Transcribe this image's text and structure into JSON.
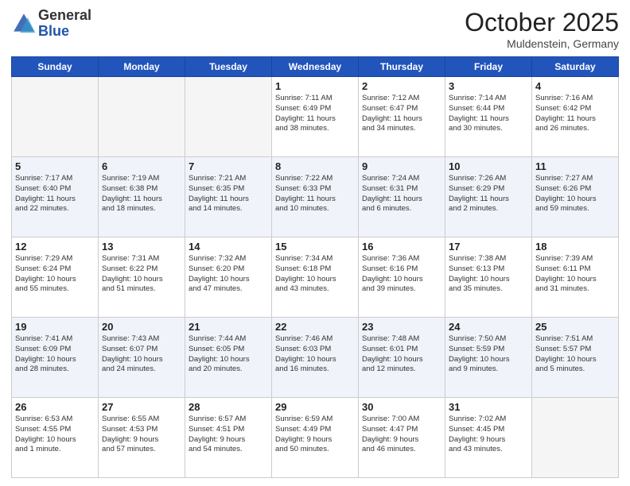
{
  "header": {
    "logo_general": "General",
    "logo_blue": "Blue",
    "month_title": "October 2025",
    "location": "Muldenstein, Germany"
  },
  "days_of_week": [
    "Sunday",
    "Monday",
    "Tuesday",
    "Wednesday",
    "Thursday",
    "Friday",
    "Saturday"
  ],
  "weeks": [
    {
      "days": [
        {
          "number": "",
          "info": ""
        },
        {
          "number": "",
          "info": ""
        },
        {
          "number": "",
          "info": ""
        },
        {
          "number": "1",
          "info": "Sunrise: 7:11 AM\nSunset: 6:49 PM\nDaylight: 11 hours\nand 38 minutes."
        },
        {
          "number": "2",
          "info": "Sunrise: 7:12 AM\nSunset: 6:47 PM\nDaylight: 11 hours\nand 34 minutes."
        },
        {
          "number": "3",
          "info": "Sunrise: 7:14 AM\nSunset: 6:44 PM\nDaylight: 11 hours\nand 30 minutes."
        },
        {
          "number": "4",
          "info": "Sunrise: 7:16 AM\nSunset: 6:42 PM\nDaylight: 11 hours\nand 26 minutes."
        }
      ]
    },
    {
      "days": [
        {
          "number": "5",
          "info": "Sunrise: 7:17 AM\nSunset: 6:40 PM\nDaylight: 11 hours\nand 22 minutes."
        },
        {
          "number": "6",
          "info": "Sunrise: 7:19 AM\nSunset: 6:38 PM\nDaylight: 11 hours\nand 18 minutes."
        },
        {
          "number": "7",
          "info": "Sunrise: 7:21 AM\nSunset: 6:35 PM\nDaylight: 11 hours\nand 14 minutes."
        },
        {
          "number": "8",
          "info": "Sunrise: 7:22 AM\nSunset: 6:33 PM\nDaylight: 11 hours\nand 10 minutes."
        },
        {
          "number": "9",
          "info": "Sunrise: 7:24 AM\nSunset: 6:31 PM\nDaylight: 11 hours\nand 6 minutes."
        },
        {
          "number": "10",
          "info": "Sunrise: 7:26 AM\nSunset: 6:29 PM\nDaylight: 11 hours\nand 2 minutes."
        },
        {
          "number": "11",
          "info": "Sunrise: 7:27 AM\nSunset: 6:26 PM\nDaylight: 10 hours\nand 59 minutes."
        }
      ]
    },
    {
      "days": [
        {
          "number": "12",
          "info": "Sunrise: 7:29 AM\nSunset: 6:24 PM\nDaylight: 10 hours\nand 55 minutes."
        },
        {
          "number": "13",
          "info": "Sunrise: 7:31 AM\nSunset: 6:22 PM\nDaylight: 10 hours\nand 51 minutes."
        },
        {
          "number": "14",
          "info": "Sunrise: 7:32 AM\nSunset: 6:20 PM\nDaylight: 10 hours\nand 47 minutes."
        },
        {
          "number": "15",
          "info": "Sunrise: 7:34 AM\nSunset: 6:18 PM\nDaylight: 10 hours\nand 43 minutes."
        },
        {
          "number": "16",
          "info": "Sunrise: 7:36 AM\nSunset: 6:16 PM\nDaylight: 10 hours\nand 39 minutes."
        },
        {
          "number": "17",
          "info": "Sunrise: 7:38 AM\nSunset: 6:13 PM\nDaylight: 10 hours\nand 35 minutes."
        },
        {
          "number": "18",
          "info": "Sunrise: 7:39 AM\nSunset: 6:11 PM\nDaylight: 10 hours\nand 31 minutes."
        }
      ]
    },
    {
      "days": [
        {
          "number": "19",
          "info": "Sunrise: 7:41 AM\nSunset: 6:09 PM\nDaylight: 10 hours\nand 28 minutes."
        },
        {
          "number": "20",
          "info": "Sunrise: 7:43 AM\nSunset: 6:07 PM\nDaylight: 10 hours\nand 24 minutes."
        },
        {
          "number": "21",
          "info": "Sunrise: 7:44 AM\nSunset: 6:05 PM\nDaylight: 10 hours\nand 20 minutes."
        },
        {
          "number": "22",
          "info": "Sunrise: 7:46 AM\nSunset: 6:03 PM\nDaylight: 10 hours\nand 16 minutes."
        },
        {
          "number": "23",
          "info": "Sunrise: 7:48 AM\nSunset: 6:01 PM\nDaylight: 10 hours\nand 12 minutes."
        },
        {
          "number": "24",
          "info": "Sunrise: 7:50 AM\nSunset: 5:59 PM\nDaylight: 10 hours\nand 9 minutes."
        },
        {
          "number": "25",
          "info": "Sunrise: 7:51 AM\nSunset: 5:57 PM\nDaylight: 10 hours\nand 5 minutes."
        }
      ]
    },
    {
      "days": [
        {
          "number": "26",
          "info": "Sunrise: 6:53 AM\nSunset: 4:55 PM\nDaylight: 10 hours\nand 1 minute."
        },
        {
          "number": "27",
          "info": "Sunrise: 6:55 AM\nSunset: 4:53 PM\nDaylight: 9 hours\nand 57 minutes."
        },
        {
          "number": "28",
          "info": "Sunrise: 6:57 AM\nSunset: 4:51 PM\nDaylight: 9 hours\nand 54 minutes."
        },
        {
          "number": "29",
          "info": "Sunrise: 6:59 AM\nSunset: 4:49 PM\nDaylight: 9 hours\nand 50 minutes."
        },
        {
          "number": "30",
          "info": "Sunrise: 7:00 AM\nSunset: 4:47 PM\nDaylight: 9 hours\nand 46 minutes."
        },
        {
          "number": "31",
          "info": "Sunrise: 7:02 AM\nSunset: 4:45 PM\nDaylight: 9 hours\nand 43 minutes."
        },
        {
          "number": "",
          "info": ""
        }
      ]
    }
  ]
}
